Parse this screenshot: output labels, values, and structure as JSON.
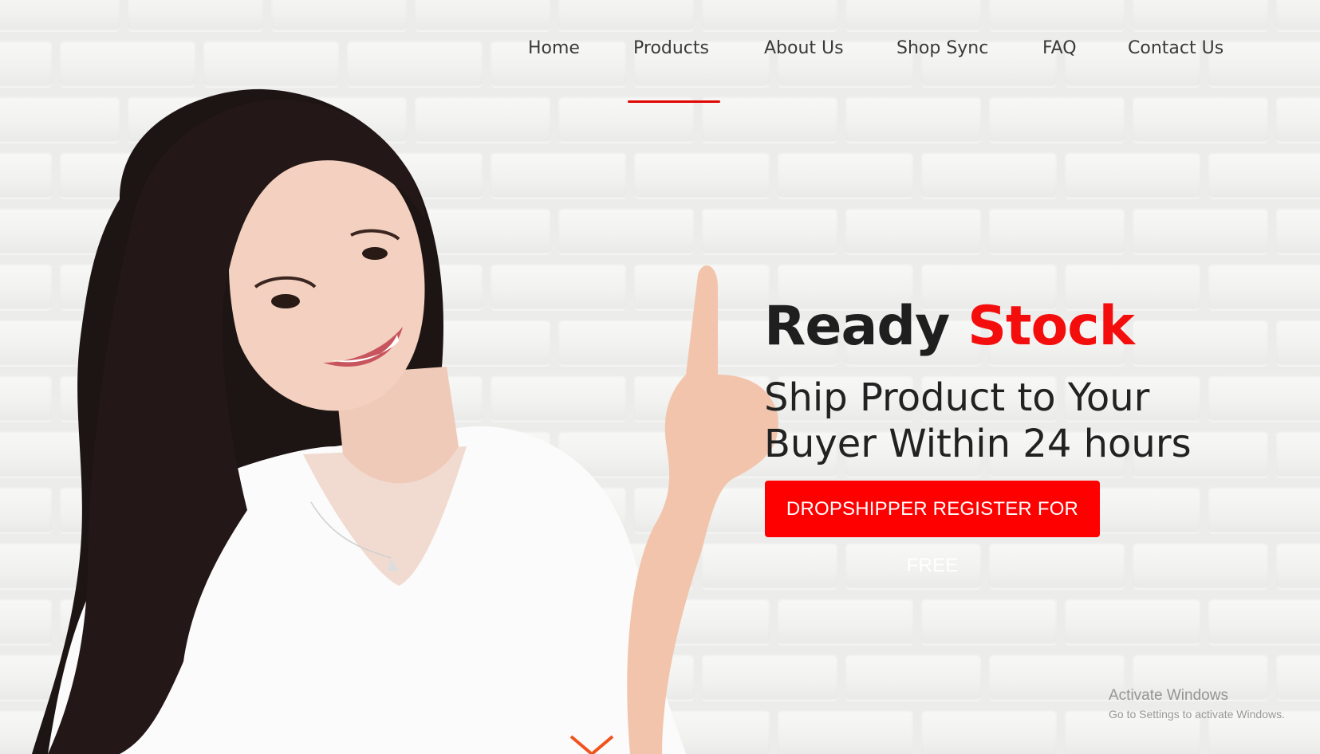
{
  "nav": {
    "items": [
      {
        "label": "Home"
      },
      {
        "label": "Products"
      },
      {
        "label": "About Us"
      },
      {
        "label": "Shop Sync"
      },
      {
        "label": "FAQ"
      },
      {
        "label": "Contact Us"
      }
    ],
    "active_index": 1
  },
  "hero": {
    "title_part1": "Ready",
    "title_part2": "Stock",
    "subtitle_line1": "Ship Product to Your",
    "subtitle_line2": "Buyer Within 24 hours",
    "cta_label": "DROPSHIPPER REGISTER FOR FREE"
  },
  "colors": {
    "accent": "#f40d0d",
    "cta_bg": "#ff0000",
    "text_dark": "#1f1f1f",
    "arrow": "#f0541e"
  },
  "icons": {
    "scroll": "chevron-down-icon"
  },
  "watermark": {
    "title": "Activate Windows",
    "subtitle": "Go to Settings to activate Windows."
  }
}
